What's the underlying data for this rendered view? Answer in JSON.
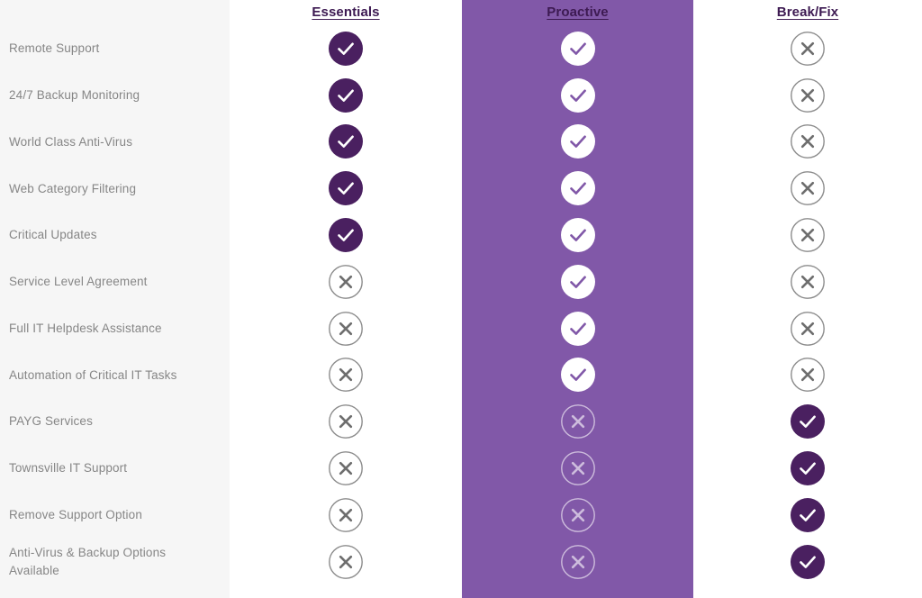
{
  "table": {
    "feature_column_header": "",
    "columns": [
      {
        "id": "essentials",
        "label": "Essentials",
        "highlighted": false
      },
      {
        "id": "proactive",
        "label": "Proactive",
        "highlighted": true
      },
      {
        "id": "breakfix",
        "label": "Break/Fix",
        "highlighted": false
      }
    ],
    "rows": [
      {
        "feature": "Remote Support",
        "essentials": "check",
        "proactive": "check",
        "breakfix": "cross"
      },
      {
        "feature": "24/7 Backup Monitoring",
        "essentials": "check",
        "proactive": "check",
        "breakfix": "cross"
      },
      {
        "feature": "World Class Anti-Virus",
        "essentials": "check",
        "proactive": "check",
        "breakfix": "cross"
      },
      {
        "feature": "Web Category Filtering",
        "essentials": "check",
        "proactive": "check",
        "breakfix": "cross"
      },
      {
        "feature": "Critical Updates",
        "essentials": "check",
        "proactive": "check",
        "breakfix": "cross"
      },
      {
        "feature": "Service Level Agreement",
        "essentials": "cross",
        "proactive": "check",
        "breakfix": "cross"
      },
      {
        "feature": "Full IT Helpdesk Assistance",
        "essentials": "cross",
        "proactive": "check",
        "breakfix": "cross"
      },
      {
        "feature": "Automation of Critical IT Tasks",
        "essentials": "cross",
        "proactive": "check",
        "breakfix": "cross"
      },
      {
        "feature": "PAYG Services",
        "essentials": "cross",
        "proactive": "cross",
        "breakfix": "check"
      },
      {
        "feature": "Townsville IT Support",
        "essentials": "cross",
        "proactive": "cross",
        "breakfix": "check"
      },
      {
        "feature": "Remove Support Option",
        "essentials": "cross",
        "proactive": "cross",
        "breakfix": "check"
      },
      {
        "feature": "Anti-Virus & Backup Options Available",
        "essentials": "cross",
        "proactive": "cross",
        "breakfix": "check"
      }
    ]
  },
  "icons": {
    "check": "check-icon",
    "cross": "cross-icon"
  },
  "colors": {
    "header_text": "#3d1a52",
    "highlight_band": "#8158a8",
    "feature_band": "#f6f6f6",
    "check_dark": "#4a2060",
    "cross_grey": "#8c8c8c",
    "cross_light": "#cdbcdc",
    "feature_text": "#868686"
  }
}
